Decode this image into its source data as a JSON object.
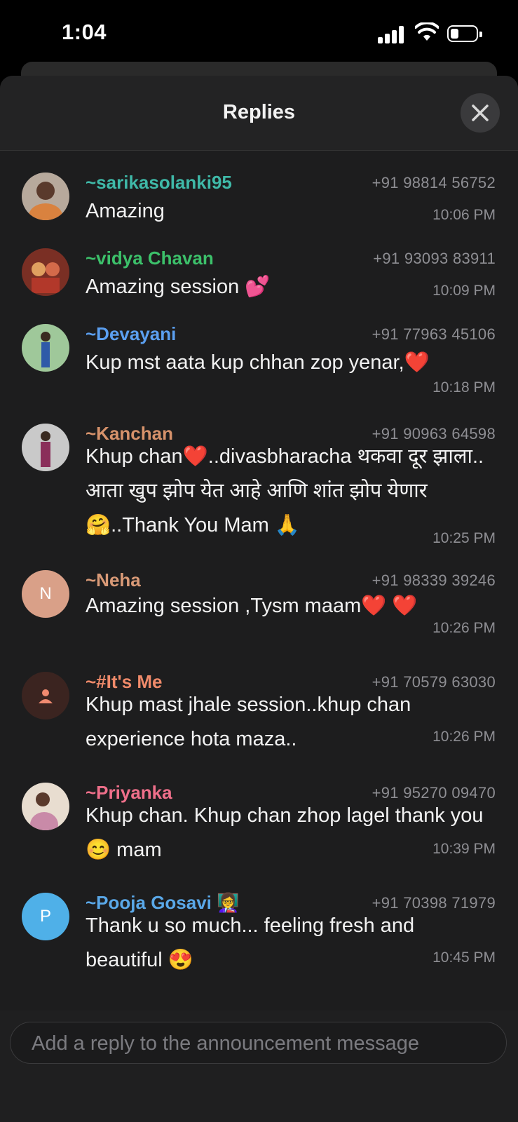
{
  "status_bar": {
    "time": "1:04"
  },
  "sheet": {
    "title": "Replies"
  },
  "replies": [
    {
      "name": "~sarikasolanki95",
      "name_color": "#3fb9a8",
      "phone": "+91 98814 56752",
      "message": "Amazing",
      "time": "10:06 PM",
      "avatar_color": "#8a6a5a"
    },
    {
      "name": "~vidya Chavan",
      "name_color": "#3cc06a",
      "phone": "+91 93093 83911",
      "message": "Amazing session 💕",
      "time": "10:09 PM",
      "avatar_color": "#a0493a"
    },
    {
      "name": "~Devayani",
      "name_color": "#5b9ff0",
      "phone": "+91 77963 45106",
      "message": "Kup mst aata kup chhan zop yenar,❤️",
      "time": "10:18 PM",
      "avatar_color": "#6e9a72"
    },
    {
      "name": "~Kanchan",
      "name_color": "#d6926b",
      "phone": "+91 90963 64598",
      "message": "Khup chan❤️..divasbharacha थकवा दूर झाला.. आता खुप झोप येत आहे आणि शांत झोप येणार 🤗..Thank You Mam 🙏",
      "time": "10:25 PM",
      "avatar_color": "#6b5b6e"
    },
    {
      "name": "~Neha",
      "name_color": "#d99a77",
      "phone": "+91 98339 39246",
      "message": "Amazing session ,Tysm maam❤️ ❤️",
      "time": "10:26 PM",
      "avatar_initial": "N",
      "avatar_color": "#d9a088"
    },
    {
      "name": "~#It's Me",
      "name_color": "#ef8a6a",
      "phone": "+91 70579 63030",
      "message": "Khup mast jhale session..khup chan experience hota maza..",
      "time": "10:26 PM",
      "avatar_color": "#3b2420",
      "avatar_icon": "person-icon"
    },
    {
      "name": "~Priyanka",
      "name_color": "#ef6f8a",
      "phone": "+91 95270 09470",
      "message": "Khup chan. Khup chan zhop lagel thank you 😊 mam",
      "time": "10:39 PM",
      "avatar_color": "#c9a89a"
    },
    {
      "name": "~Pooja Gosavi 👩‍🏫",
      "name_color": "#5aa8e8",
      "phone": "+91 70398 71979",
      "message": "Thank u so much... feeling fresh and beautiful 😍",
      "time": "10:45 PM",
      "avatar_initial": "P",
      "avatar_color": "#4fb0e8"
    }
  ],
  "composer": {
    "placeholder": "Add a reply to the announcement message"
  }
}
